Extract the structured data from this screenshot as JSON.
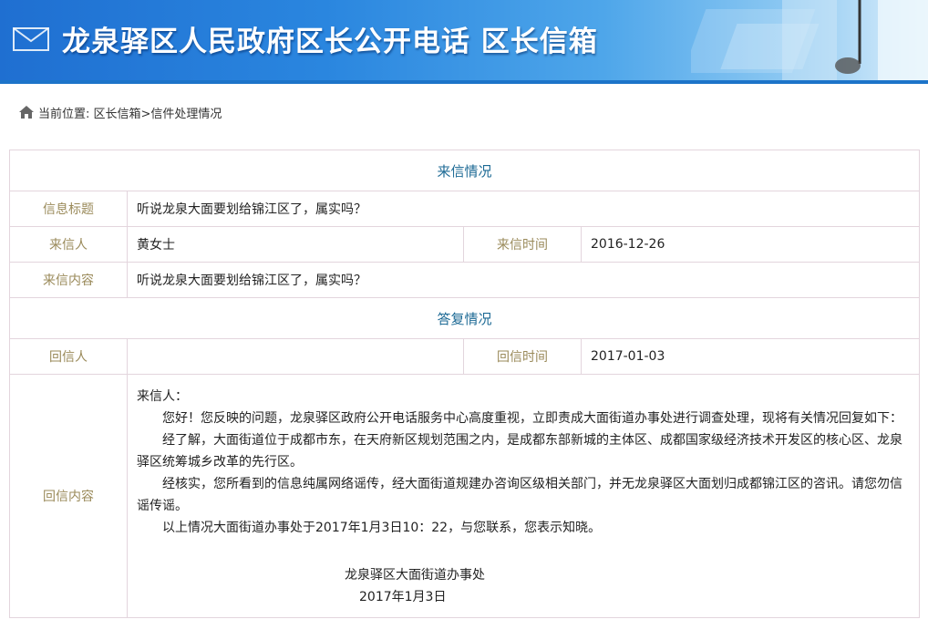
{
  "banner": {
    "title": "龙泉驿区人民政府区长公开电话  区长信箱"
  },
  "breadcrumb": {
    "text": "当前位置: 区长信箱>信件处理情况"
  },
  "letter": {
    "section_title": "来信情况",
    "subject_label": "信息标题",
    "subject": "听说龙泉大面要划给锦江区了，属实吗？",
    "sender_label": "来信人",
    "sender": "黄女士",
    "time_label": "来信时间",
    "time": "2016-12-26",
    "content_label": "来信内容",
    "content": "听说龙泉大面要划给锦江区了，属实吗？"
  },
  "reply": {
    "section_title": "答复情况",
    "replier_label": "回信人",
    "replier": "",
    "time_label": "回信时间",
    "time": "2017-01-03",
    "content_label": "回信内容",
    "greeting": "来信人：",
    "para1": "您好！您反映的问题，龙泉驿区政府公开电话服务中心高度重视，立即责成大面街道办事处进行调查处理，现将有关情况回复如下：",
    "para2": "经了解，大面街道位于成都市东，在天府新区规划范围之内，是成都东部新城的主体区、成都国家级经济技术开发区的核心区、龙泉驿区统筹城乡改革的先行区。",
    "para3": "经核实，您所看到的信息纯属网络谣传，经大面街道规建办咨询区级相关部门，并无龙泉驿区大面划归成都锦江区的咨讯。请您勿信谣传谣。",
    "para4": "以上情况大面街道办事处于2017年1月3日10：22，与您联系，您表示知晓。",
    "signature": "龙泉驿区大面街道办事处",
    "date": "2017年1月3日"
  }
}
